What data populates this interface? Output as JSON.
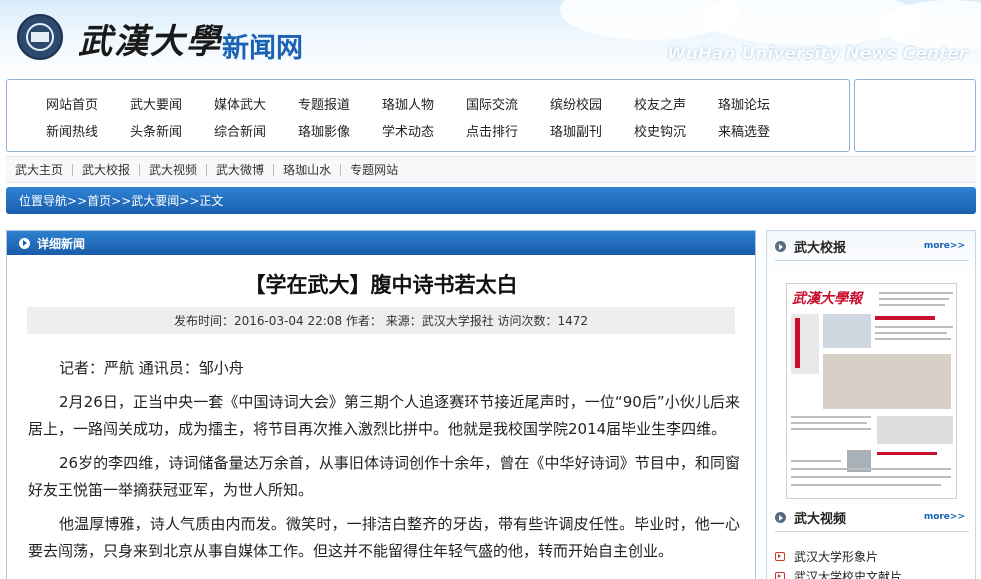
{
  "header": {
    "logo_cn": "武漢大學",
    "logo_news": "新闻网",
    "logo_en": "WuHan University News Center"
  },
  "nav": {
    "row1": [
      "网站首页",
      "武大要闻",
      "媒体武大",
      "专题报道",
      "珞珈人物",
      "国际交流",
      "缤纷校园",
      "校友之声",
      "珞珈论坛"
    ],
    "row2": [
      "新闻热线",
      "头条新闻",
      "综合新闻",
      "珞珈影像",
      "学术动态",
      "点击排行",
      "珞珈副刊",
      "校史钩沉",
      "来稿选登"
    ]
  },
  "subnav": [
    "武大主页",
    "武大校报",
    "武大视频",
    "武大微博",
    "珞珈山水",
    "专题网站"
  ],
  "breadcrumb": {
    "label": "位置导航",
    "sep": ">>",
    "items": [
      "首页",
      "武大要闻",
      "正文"
    ]
  },
  "article": {
    "section_title": "详细新闻",
    "title": "【学在武大】腹中诗书若太白",
    "meta": "发布时间：2016-03-04 22:08   作者：   来源：武汉大学报社   访问次数：1472",
    "paragraphs": [
      "记者：严航 通讯员：邹小舟",
      "2月26日，正当中央一套《中国诗词大会》第三期个人追逐赛环节接近尾声时，一位“90后”小伙儿后来居上，一路闯关成功，成为擂主，将节目再次推入激烈比拼中。他就是我校国学院2014届毕业生李四维。",
      "26岁的李四维，诗词储备量达万余首，从事旧体诗词创作十余年，曾在《中华好诗词》节目中，和同窗好友王悦笛一举摘获冠亚军，为世人所知。",
      "他温厚博雅，诗人气质由内而发。微笑时，一排洁白整齐的牙齿，带有些许调皮任性。毕业时，他一心要去闯荡，只身来到北京从事自媒体工作。但这并不能留得住年轻气盛的他，转而开始自主创业。"
    ]
  },
  "sidebar": {
    "paper_section": {
      "title": "武大校报",
      "more": "more>>"
    },
    "paper_masthead": "武漢大學報",
    "video_section": {
      "title": "武大视频",
      "more": "more>>"
    },
    "videos": [
      "武汉大学形象片",
      "武汉大学校史文献片"
    ]
  }
}
